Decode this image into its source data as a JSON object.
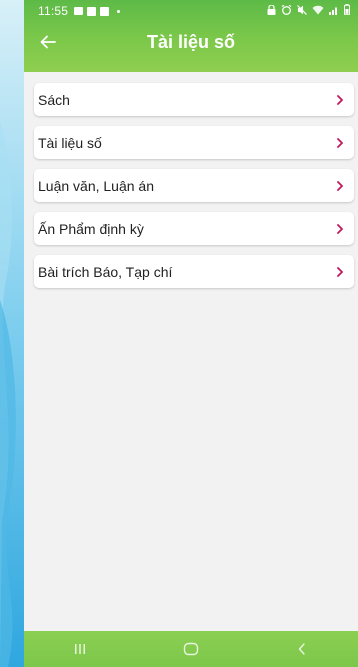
{
  "status_bar": {
    "time": "11:55"
  },
  "header": {
    "title": "Tài liệu số"
  },
  "menu": {
    "items": [
      {
        "label": "Sách"
      },
      {
        "label": "Tài liệu số"
      },
      {
        "label": "Luận văn, Luận án"
      },
      {
        "label": "Ấn Phẩm định kỳ"
      },
      {
        "label": "Bài trích Báo, Tạp chí"
      }
    ]
  },
  "colors": {
    "header_green": "#6cc24a",
    "chevron": "#c2185b",
    "nav_green": "#7cc74a",
    "background": "#f2f2f2"
  },
  "icons": {
    "back": "arrow-left-icon",
    "chevron": "chevron-right-icon",
    "nav_recents": "recents-icon",
    "nav_home": "home-icon",
    "nav_back": "back-icon"
  }
}
